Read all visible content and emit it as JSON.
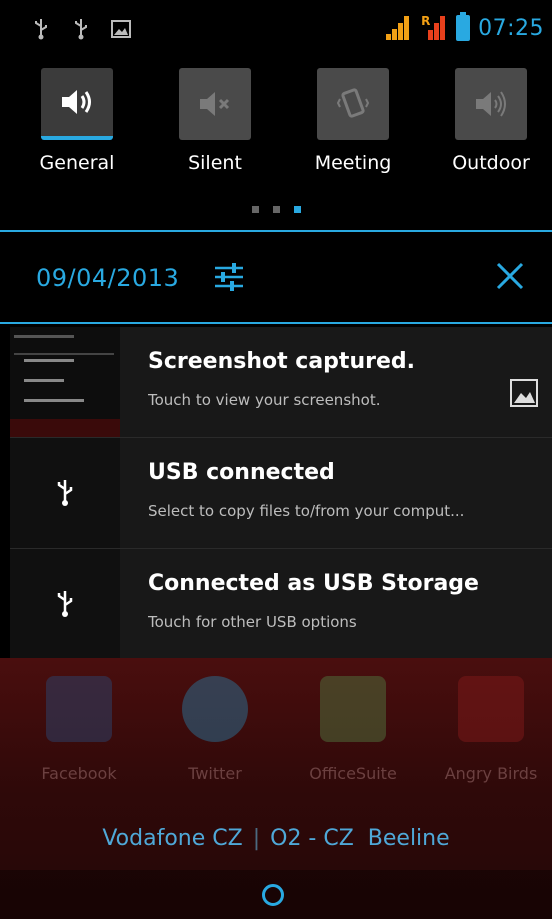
{
  "status_bar": {
    "left_icons": [
      "usb-icon",
      "usb-icon",
      "image-icon"
    ],
    "right_icons": [
      "signal-icon",
      "roaming-signal-icon",
      "battery-icon"
    ],
    "time": "07:25",
    "accent_color": "#29a9e1"
  },
  "profiles": {
    "items": [
      {
        "label": "General",
        "icon": "volume-icon",
        "active": true
      },
      {
        "label": "Silent",
        "icon": "mute-icon",
        "active": false
      },
      {
        "label": "Meeting",
        "icon": "vibrate-icon",
        "active": false
      },
      {
        "label": "Outdoor",
        "icon": "loud-volume-icon",
        "active": false
      }
    ],
    "page_count": 3,
    "current_page": 3
  },
  "header": {
    "date": "09/04/2013",
    "settings_icon": "settings-sliders-icon",
    "clear_icon": "close-icon"
  },
  "notifications": [
    {
      "title": "Screenshot captured.",
      "subtitle": "Touch to view your screenshot.",
      "icon": "screenshot-thumbnail",
      "right_icon": "image-icon"
    },
    {
      "title": "USB connected",
      "subtitle": "Select to copy files to/from your comput...",
      "icon": "usb-icon"
    },
    {
      "title": "Connected as USB Storage",
      "subtitle": "Touch for other USB options",
      "icon": "usb-icon"
    }
  ],
  "background_apps": [
    {
      "label": "Facebook"
    },
    {
      "label": "Twitter"
    },
    {
      "label": "OfficeSuite"
    },
    {
      "label": "Angry Birds"
    }
  ],
  "carrier": {
    "left": "Vodafone CZ",
    "separator": "|",
    "right": "O2 - CZ  Beeline"
  }
}
